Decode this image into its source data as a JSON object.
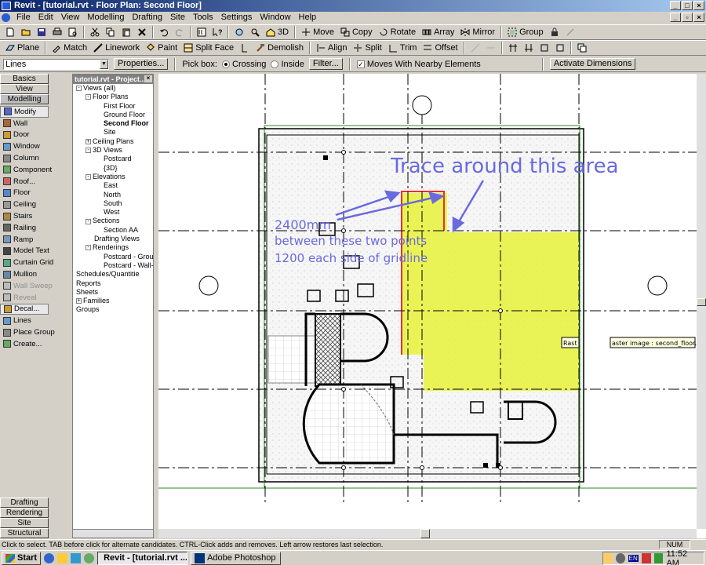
{
  "window": {
    "title": "Revit - [tutorial.rvt - Floor Plan: Second Floor]"
  },
  "menu": [
    "File",
    "Edit",
    "View",
    "Modelling",
    "Drafting",
    "Site",
    "Tools",
    "Settings",
    "Window",
    "Help"
  ],
  "toolbar1": {
    "three_d": "3D",
    "move": "Move",
    "copy": "Copy",
    "rotate": "Rotate",
    "array": "Array",
    "mirror": "Mirror",
    "group": "Group"
  },
  "toolbar2": {
    "plane": "Plane",
    "match": "Match",
    "linework": "Linework",
    "paint": "Paint",
    "split_face": "Split Face",
    "demolish": "Demolish",
    "align": "Align",
    "split": "Split",
    "trim": "Trim",
    "offset": "Offset"
  },
  "options": {
    "type_select": "Lines",
    "properties": "Properties...",
    "pick_box": "Pick box:",
    "crossing": "Crossing",
    "inside": "Inside",
    "filter": "Filter...",
    "moves_with": "Moves With Nearby Elements",
    "activate_dims": "Activate Dimensions"
  },
  "design_bar": {
    "tabs_top": [
      "Basics",
      "View",
      "Modelling"
    ],
    "tools": [
      {
        "label": "Modify",
        "icon": "arrow-cursor-icon",
        "state": "active"
      },
      {
        "label": "Wall",
        "icon": "wall-icon",
        "state": ""
      },
      {
        "label": "Door",
        "icon": "door-icon",
        "state": ""
      },
      {
        "label": "Window",
        "icon": "window-icon",
        "state": ""
      },
      {
        "label": "Column",
        "icon": "column-icon",
        "state": ""
      },
      {
        "label": "Component",
        "icon": "component-icon",
        "state": ""
      },
      {
        "label": "Roof...",
        "icon": "roof-icon",
        "state": ""
      },
      {
        "label": "Floor",
        "icon": "floor-icon",
        "state": ""
      },
      {
        "label": "Ceiling",
        "icon": "ceiling-icon",
        "state": ""
      },
      {
        "label": "Stairs",
        "icon": "stairs-icon",
        "state": ""
      },
      {
        "label": "Railing",
        "icon": "railing-icon",
        "state": ""
      },
      {
        "label": "Ramp",
        "icon": "ramp-icon",
        "state": ""
      },
      {
        "label": "Model Text",
        "icon": "model-text-icon",
        "state": ""
      },
      {
        "label": "Curtain Grid",
        "icon": "curtain-grid-icon",
        "state": ""
      },
      {
        "label": "Mullion",
        "icon": "mullion-icon",
        "state": ""
      },
      {
        "label": "Wall Sweep",
        "icon": "wall-sweep-icon",
        "state": "disabled"
      },
      {
        "label": "Reveal",
        "icon": "reveal-icon",
        "state": "disabled"
      },
      {
        "label": "Decal...",
        "icon": "decal-icon",
        "state": "active"
      },
      {
        "label": "Lines",
        "icon": "lines-icon",
        "state": ""
      },
      {
        "label": "Place Group",
        "icon": "place-group-icon",
        "state": ""
      },
      {
        "label": "Create...",
        "icon": "create-icon",
        "state": ""
      }
    ],
    "tabs_bottom": [
      "Drafting",
      "Rendering",
      "Site",
      "Structural"
    ]
  },
  "browser": {
    "title": "tutorial.rvt - Project...",
    "tree": [
      {
        "label": "Views (all)",
        "level": 0,
        "toggle": "-",
        "bold": false
      },
      {
        "label": "Floor Plans",
        "level": 1,
        "toggle": "-",
        "bold": false
      },
      {
        "label": "First Floor",
        "level": 2,
        "toggle": "",
        "bold": false
      },
      {
        "label": "Ground Floor",
        "level": 2,
        "toggle": "",
        "bold": false
      },
      {
        "label": "Second Floor",
        "level": 2,
        "toggle": "",
        "bold": true
      },
      {
        "label": "Site",
        "level": 2,
        "toggle": "",
        "bold": false
      },
      {
        "label": "Ceiling Plans",
        "level": 1,
        "toggle": "+",
        "bold": false
      },
      {
        "label": "3D Views",
        "level": 1,
        "toggle": "-",
        "bold": false
      },
      {
        "label": "Postcard",
        "level": 2,
        "toggle": "",
        "bold": false
      },
      {
        "label": "{3D}",
        "level": 2,
        "toggle": "",
        "bold": false
      },
      {
        "label": "Elevations",
        "level": 1,
        "toggle": "-",
        "bold": false
      },
      {
        "label": "East",
        "level": 2,
        "toggle": "",
        "bold": false
      },
      {
        "label": "North",
        "level": 2,
        "toggle": "",
        "bold": false
      },
      {
        "label": "South",
        "level": 2,
        "toggle": "",
        "bold": false
      },
      {
        "label": "West",
        "level": 2,
        "toggle": "",
        "bold": false
      },
      {
        "label": "Sections",
        "level": 1,
        "toggle": "-",
        "bold": false
      },
      {
        "label": "Section AA",
        "level": 2,
        "toggle": "",
        "bold": false
      },
      {
        "label": "Drafting Views",
        "level": 1,
        "toggle": "",
        "bold": false
      },
      {
        "label": "Renderings",
        "level": 1,
        "toggle": "-",
        "bold": false
      },
      {
        "label": "Postcard - Grou",
        "level": 2,
        "toggle": "",
        "bold": false
      },
      {
        "label": "Postcard - Wall-",
        "level": 2,
        "toggle": "",
        "bold": false
      },
      {
        "label": "Schedules/Quantitie",
        "level": 0,
        "toggle": "",
        "bold": false
      },
      {
        "label": "Reports",
        "level": 0,
        "toggle": "",
        "bold": false
      },
      {
        "label": "Sheets",
        "level": 0,
        "toggle": "",
        "bold": false
      },
      {
        "label": "Families",
        "level": 0,
        "toggle": "+",
        "bold": false
      },
      {
        "label": "Groups",
        "level": 0,
        "toggle": "",
        "bold": false
      }
    ]
  },
  "canvas": {
    "annotation_title": "Trace around this area",
    "annotation_dim": "2400mm",
    "annotation_line2": "between these two points",
    "annotation_line3": "1200 each side of gridline",
    "tooltip_short": "Rast",
    "tooltip_full": "aster image : second_floor.jpg",
    "colors": {
      "highlight": "#e8f23a",
      "annotation": "#6a6adf",
      "trace_line": "#e83030"
    }
  },
  "status": {
    "message": "Click to select. TAB before click for alternate candidates. CTRL-Click adds and removes. Left arrow restores last selection.",
    "num": "NUM"
  },
  "taskbar": {
    "start": "Start",
    "revit_task": "Revit - [tutorial.rvt ...",
    "photoshop_task": "Adobe Photoshop",
    "lang": "EN",
    "time": "11:52 AM"
  }
}
